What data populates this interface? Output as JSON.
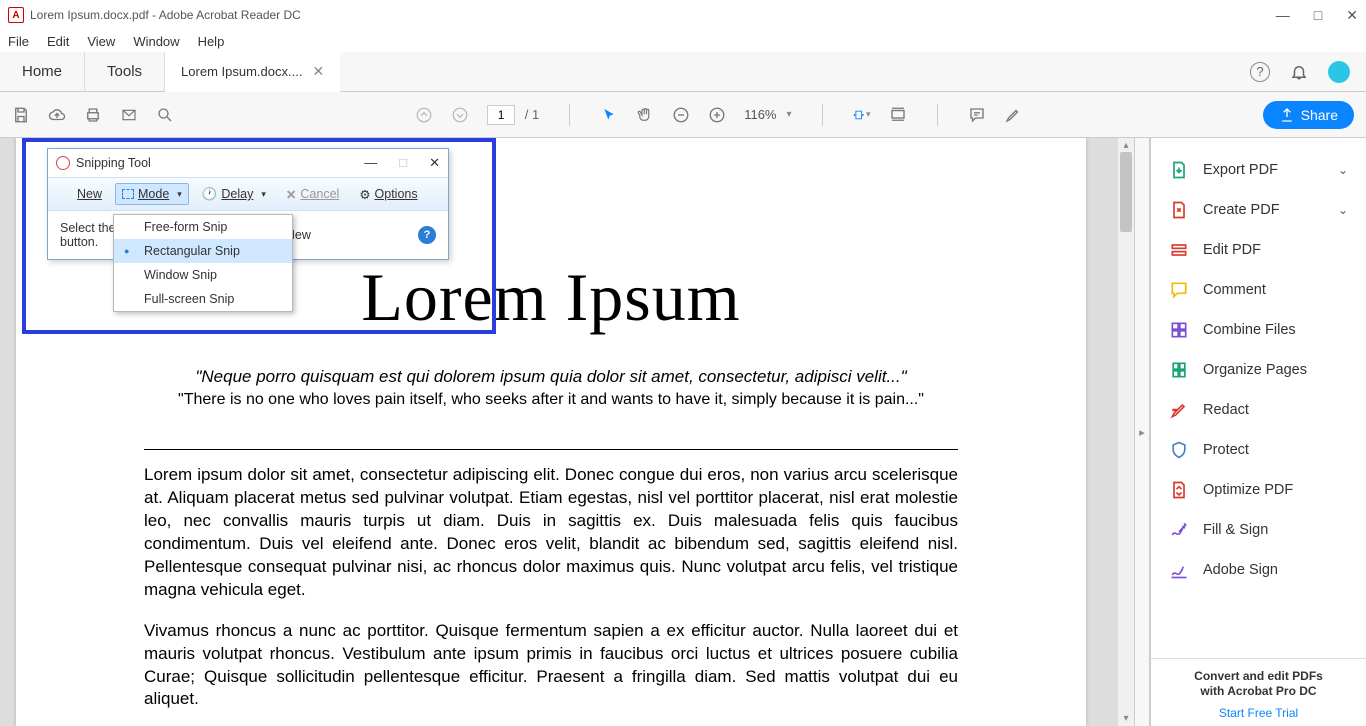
{
  "titlebar": {
    "filename": "Lorem Ipsum.docx.pdf",
    "app": "Adobe Acrobat Reader DC"
  },
  "menu": [
    "File",
    "Edit",
    "View",
    "Window",
    "Help"
  ],
  "navtabs": {
    "home": "Home",
    "tools": "Tools"
  },
  "doctab": {
    "label": "Lorem Ipsum.docx...."
  },
  "toolbar": {
    "page_current": "1",
    "page_total": "/ 1",
    "zoom": "116%"
  },
  "share": {
    "label": "Share"
  },
  "doc": {
    "title": "Lorem Ipsum",
    "quote1": "\"Neque porro quisquam est qui dolorem ipsum quia dolor sit amet, consectetur, adipisci velit...\"",
    "quote2": "\"There is no one who loves pain itself, who seeks after it and wants to have it, simply because it is pain...\"",
    "p1": "Lorem ipsum dolor sit amet, consectetur adipiscing elit. Donec congue dui eros, non varius arcu scelerisque at. Aliquam placerat metus sed pulvinar volutpat. Etiam egestas, nisl vel porttitor placerat, nisl erat molestie leo, nec convallis mauris turpis ut diam. Duis in sagittis ex. Duis malesuada felis quis faucibus condimentum. Duis vel eleifend ante. Donec eros velit, blandit ac bibendum sed, sagittis eleifend nisl. Pellentesque consequat pulvinar nisi, ac rhoncus dolor maximus quis. Nunc volutpat arcu felis, vel tristique magna vehicula eget.",
    "p2": "Vivamus rhoncus a nunc ac porttitor. Quisque fermentum sapien a ex efficitur auctor. Nulla laoreet dui et mauris volutpat rhoncus. Vestibulum ante ipsum primis in faucibus orci luctus et ultrices posuere cubilia Curae; Quisque sollicitudin pellentesque efficitur. Praesent a fringilla diam. Sed mattis volutpat dui eu aliquet."
  },
  "rightpane": {
    "items": [
      {
        "label": "Export PDF",
        "chev": true,
        "color": "#17a673"
      },
      {
        "label": "Create PDF",
        "chev": true,
        "color": "#d93a2b"
      },
      {
        "label": "Edit PDF",
        "chev": false,
        "color": "#d93a2b"
      },
      {
        "label": "Comment",
        "chev": false,
        "color": "#f2b90f"
      },
      {
        "label": "Combine Files",
        "chev": false,
        "color": "#7a4fd1"
      },
      {
        "label": "Organize Pages",
        "chev": false,
        "color": "#17a673"
      },
      {
        "label": "Redact",
        "chev": false,
        "color": "#d93a2b"
      },
      {
        "label": "Protect",
        "chev": false,
        "color": "#4a7fc1"
      },
      {
        "label": "Optimize PDF",
        "chev": false,
        "color": "#d93a2b"
      },
      {
        "label": "Fill & Sign",
        "chev": false,
        "color": "#7a4fd1"
      },
      {
        "label": "Adobe Sign",
        "chev": false,
        "color": "#7a4fd1"
      }
    ],
    "promo1": "Convert and edit PDFs",
    "promo2": "with Acrobat Pro DC",
    "trial": "Start Free Trial"
  },
  "snip": {
    "title": "Snipping Tool",
    "new": "New",
    "mode": "Mode",
    "delay": "Delay",
    "cancel": "Cancel",
    "options": "Options",
    "hint_a": "Select the",
    "hint_b": "button.",
    "hint_c": "or click the New",
    "menu": [
      "Free-form Snip",
      "Rectangular Snip",
      "Window Snip",
      "Full-screen Snip"
    ],
    "selected": 1
  }
}
